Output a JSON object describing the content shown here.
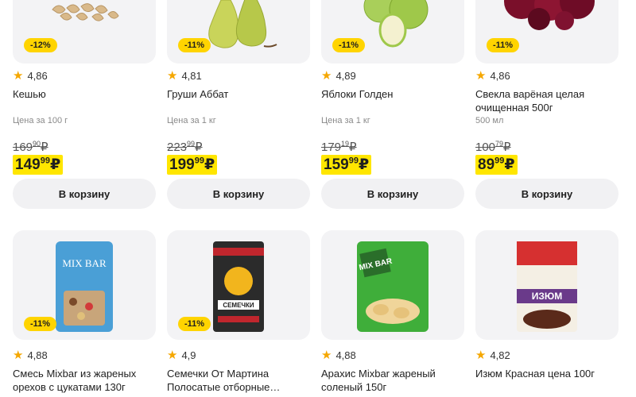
{
  "products": [
    {
      "name": "Кешью",
      "rating": "4,86",
      "discount": "-12%",
      "unit": "Цена за 100 г",
      "old_price": "169",
      "old_price_kop": "90",
      "new_price": "149",
      "new_price_kop": "99",
      "currency": "₽",
      "cart_label": "В корзину",
      "icon": "cashew-image"
    },
    {
      "name": "Груши Аббат",
      "rating": "4,81",
      "discount": "-11%",
      "unit": "Цена за 1 кг",
      "old_price": "223",
      "old_price_kop": "99",
      "new_price": "199",
      "new_price_kop": "99",
      "currency": "₽",
      "cart_label": "В корзину",
      "icon": "pear-image"
    },
    {
      "name": "Яблоки Голден",
      "rating": "4,89",
      "discount": "-11%",
      "unit": "Цена за 1 кг",
      "old_price": "179",
      "old_price_kop": "19",
      "new_price": "159",
      "new_price_kop": "99",
      "currency": "₽",
      "cart_label": "В корзину",
      "icon": "apple-image"
    },
    {
      "name": "Свекла варёная целая очищенная 500г",
      "rating": "4,86",
      "discount": "-11%",
      "unit": "500 мл",
      "old_price": "100",
      "old_price_kop": "79",
      "new_price": "89",
      "new_price_kop": "99",
      "currency": "₽",
      "cart_label": "В корзину",
      "icon": "beet-image"
    },
    {
      "name": "Смесь Mixbar из жареных орехов с цукатами 130г",
      "rating": "4,88",
      "discount": "-11%",
      "icon": "mixbar-bag-image",
      "pack_text": "MIX BAR"
    },
    {
      "name": "Семечки От Мартина Полосатые отборные…",
      "rating": "4,9",
      "discount": "-11%",
      "icon": "seeds-bag-image",
      "pack_text": "СЕМЕЧКИ"
    },
    {
      "name": "Арахис Mixbar жареный соленый 150г",
      "rating": "4,88",
      "icon": "peanut-bag-image",
      "pack_text": "MIX BAR"
    },
    {
      "name": "Изюм Красная цена 100г",
      "rating": "4,82",
      "icon": "raisin-bag-image",
      "pack_text": "ИЗЮМ"
    }
  ],
  "colors": {
    "accent_yellow": "#ffe600",
    "badge_yellow": "#ffd400",
    "star": "#f5a700",
    "card_bg": "#f3f3f5"
  }
}
